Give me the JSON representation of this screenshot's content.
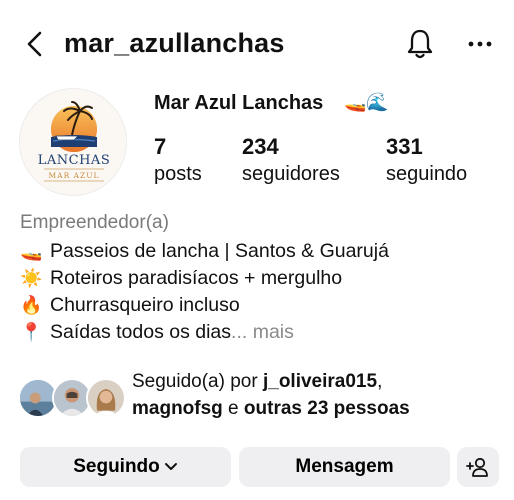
{
  "header": {
    "username": "mar_azullanchas",
    "icons": [
      "back-arrow-icon",
      "bell-icon",
      "more-icon"
    ]
  },
  "profile": {
    "display_name": "Mar Azul Lanchas",
    "display_emoji": "🚤🌊",
    "avatar_logo_text": "LANCHAS MAR AZUL"
  },
  "stats": [
    {
      "value": "7",
      "label": "posts"
    },
    {
      "value": "234",
      "label": "seguidores"
    },
    {
      "value": "331",
      "label": "seguindo"
    }
  ],
  "category": "Empreendedor(a)",
  "bio": [
    {
      "emoji": "🚤",
      "text": "Passeios de lancha | Santos & Guarujá"
    },
    {
      "emoji": "☀️",
      "text": "Roteiros paradisíacos + mergulho"
    },
    {
      "emoji": "🔥",
      "text": "Churrasqueiro incluso"
    },
    {
      "emoji": "📍",
      "text": "Saídas todos os dias"
    }
  ],
  "bio_more": "... mais",
  "followed_by": {
    "prefix": "Seguido(a) por ",
    "user1": "j_oliveira015",
    "sep1": ",",
    "user2": "magnofsg",
    "sep2": " e ",
    "others": "outras 23 pessoas"
  },
  "actions": {
    "following_label": "Seguindo",
    "message_label": "Mensagem"
  }
}
